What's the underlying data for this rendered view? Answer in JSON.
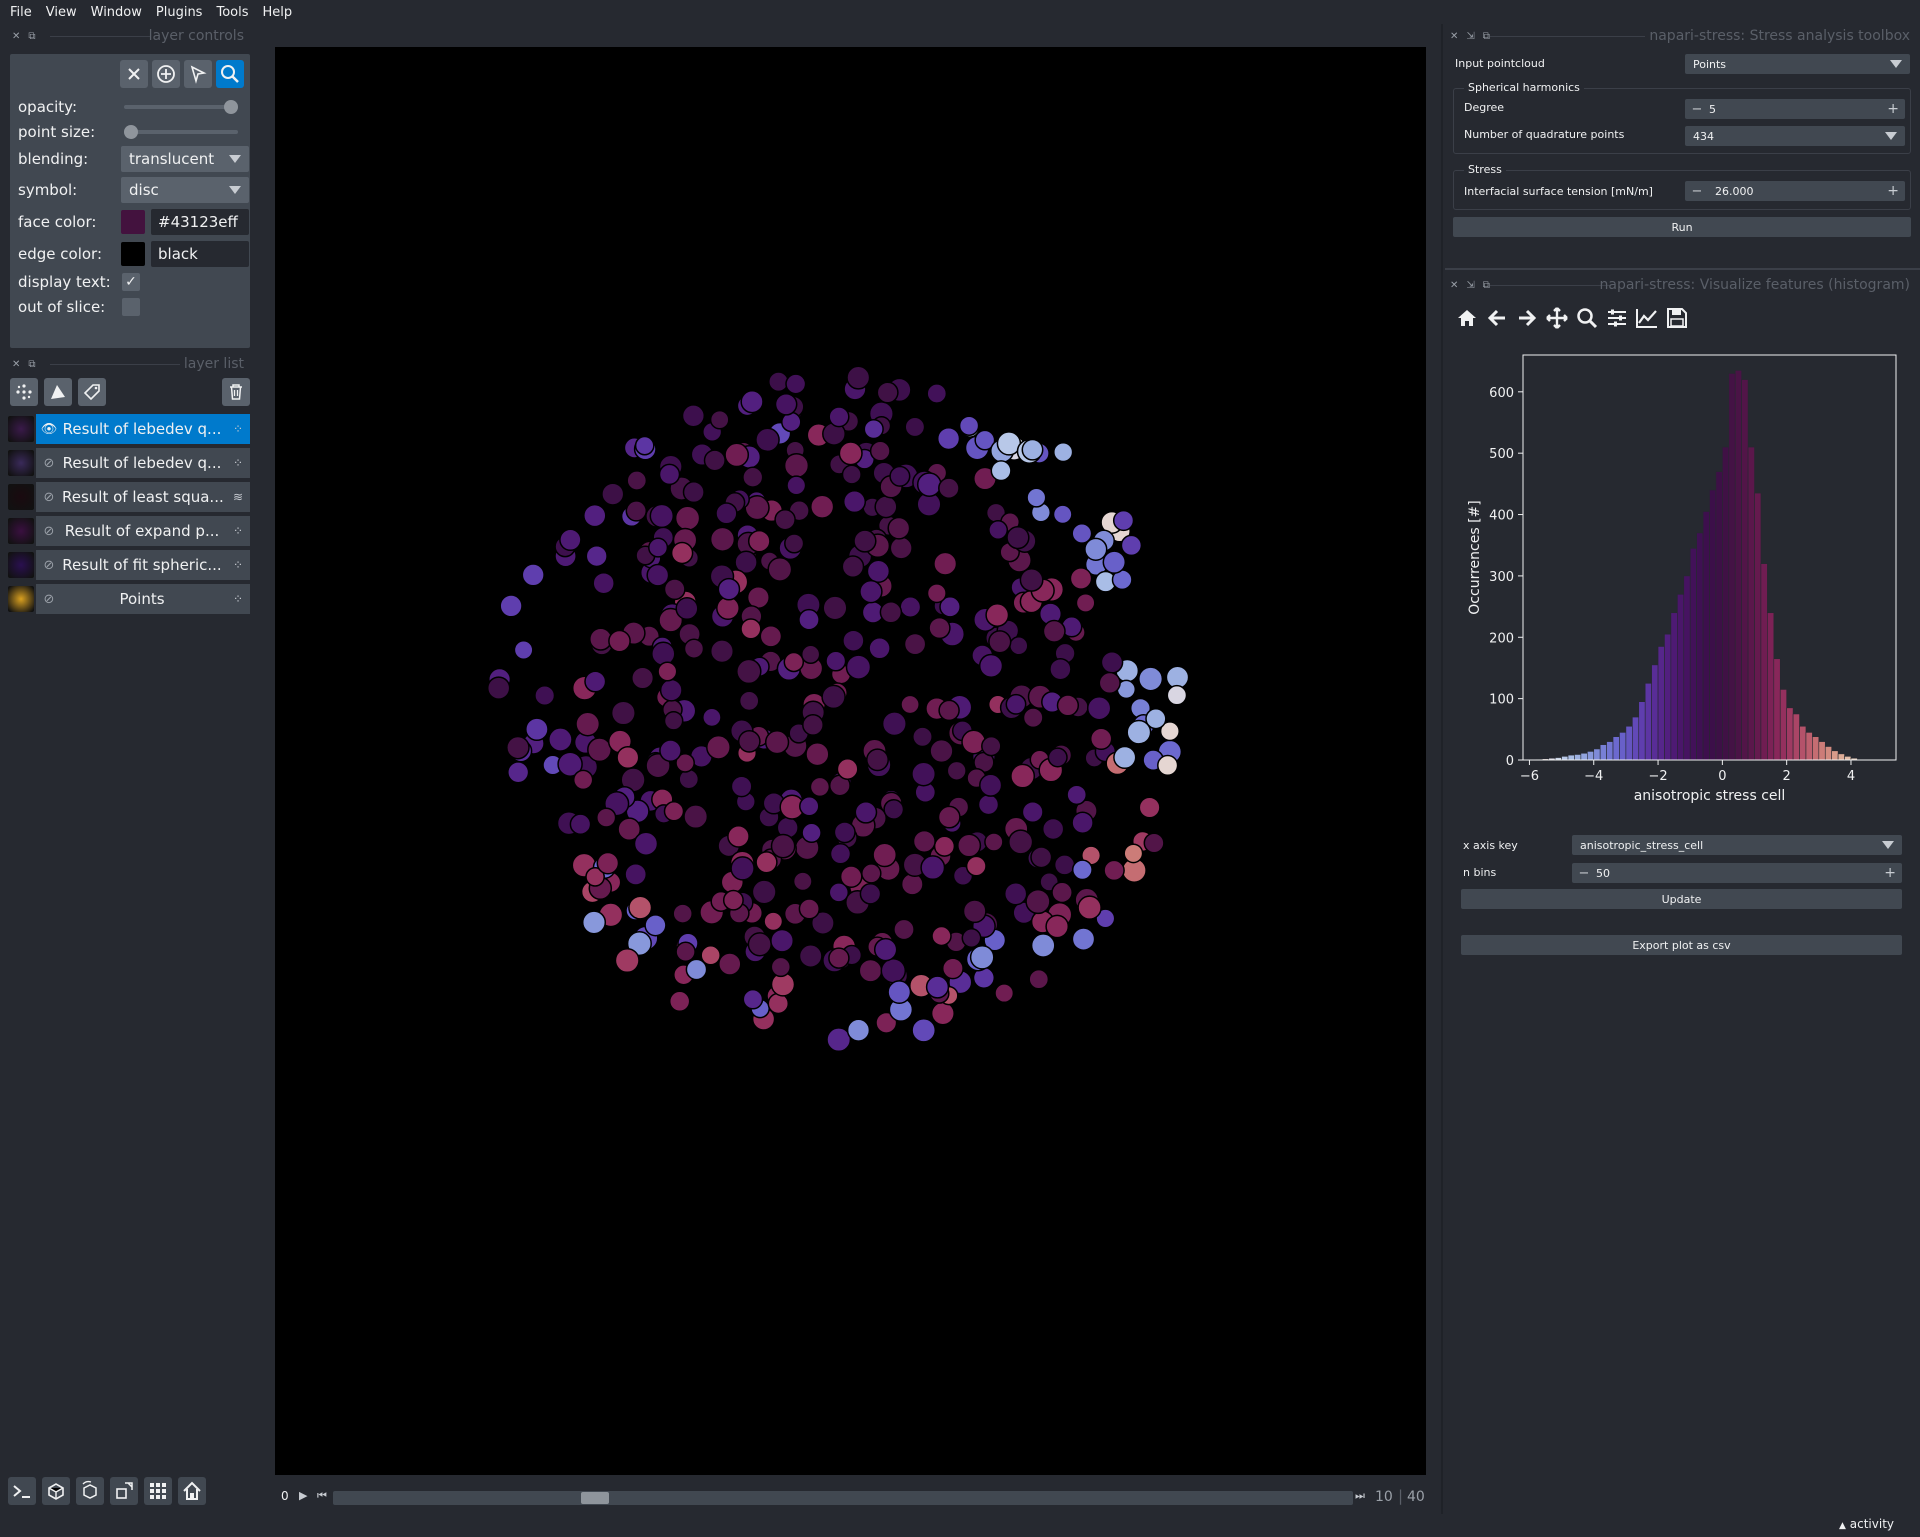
{
  "menubar": {
    "items": [
      "File",
      "View",
      "Window",
      "Plugins",
      "Tools",
      "Help"
    ]
  },
  "layer_controls": {
    "title": "layer controls",
    "opacity_label": "opacity:",
    "opacity_value": 1.0,
    "point_size_label": "point size:",
    "point_size_value": 0.0,
    "blending_label": "blending:",
    "blending_value": "translucent",
    "symbol_label": "symbol:",
    "symbol_value": "disc",
    "face_color_label": "face color:",
    "face_color_value": "#43123eff",
    "face_color_swatch": "#43123e",
    "edge_color_label": "edge color:",
    "edge_color_value": "black",
    "edge_color_swatch": "#000000",
    "display_text_label": "display text:",
    "display_text_checked": true,
    "out_of_slice_label": "out of slice:",
    "out_of_slice_checked": false
  },
  "layer_list": {
    "title": "layer list",
    "layers": [
      {
        "name": "Result of lebedev q...",
        "selected": true,
        "visible": true,
        "type": "points"
      },
      {
        "name": "Result of lebedev q...",
        "selected": false,
        "visible": false,
        "type": "points"
      },
      {
        "name": "Result of least squa...",
        "selected": false,
        "visible": false,
        "type": "vectors"
      },
      {
        "name": "Result of expand p...",
        "selected": false,
        "visible": false,
        "type": "points"
      },
      {
        "name": "Result of fit spheric...",
        "selected": false,
        "visible": false,
        "type": "points"
      },
      {
        "name": "Points",
        "selected": false,
        "visible": false,
        "type": "points"
      }
    ]
  },
  "dims": {
    "start": "0",
    "current": "10",
    "total": "40",
    "position": 0.25
  },
  "stress_toolbox": {
    "title": "napari-stress: Stress analysis toolbox",
    "input_pointcloud_label": "Input pointcloud",
    "input_pointcloud_value": "Points",
    "sph_group": "Spherical harmonics",
    "degree_label": "Degree",
    "degree_value": "5",
    "quad_label": "Number of quadrature points",
    "quad_value": "434",
    "stress_group": "Stress",
    "tension_label": "Interfacial surface tension [mN/m]",
    "tension_value": "26.000",
    "run_label": "Run"
  },
  "histogram_panel": {
    "title": "napari-stress: Visualize features (histogram)",
    "toolbar_icons": [
      "home-icon",
      "back-icon",
      "forward-icon",
      "pan-icon",
      "zoom-icon",
      "configure-icon",
      "edit-axis-icon",
      "save-icon"
    ],
    "x_axis_key_label": "x axis key",
    "x_axis_key_value": "anisotropic_stress_cell",
    "n_bins_label": "n bins",
    "n_bins_value": "50",
    "update_label": "Update",
    "export_label": "Export plot as csv"
  },
  "chart_data": {
    "type": "bar",
    "xlabel": "anisotropic stress cell",
    "ylabel": "Occurrences [#]",
    "xlim": [
      -6.2,
      5.4
    ],
    "ylim": [
      0,
      660
    ],
    "xticks": [
      -6,
      -4,
      -2,
      0,
      2,
      4
    ],
    "xtick_labels": [
      "−6",
      "−4",
      "−2",
      "0",
      "2",
      "4"
    ],
    "yticks": [
      0,
      100,
      200,
      300,
      400,
      500,
      600
    ],
    "yticks_labels": [
      "0",
      "100",
      "200",
      "300",
      "400",
      "500",
      "600"
    ],
    "bin_start": -5.8,
    "bin_width": 0.2,
    "values": [
      1,
      2,
      3,
      4,
      6,
      8,
      9,
      11,
      14,
      18,
      25,
      30,
      38,
      45,
      55,
      70,
      95,
      125,
      155,
      185,
      205,
      240,
      270,
      300,
      345,
      370,
      405,
      440,
      470,
      510,
      630,
      635,
      620,
      510,
      435,
      320,
      240,
      165,
      115,
      85,
      75,
      55,
      45,
      38,
      30,
      22,
      15,
      10,
      6,
      3
    ],
    "colors": [
      "#e8ddd8",
      "#e5d6d2",
      "#d9d6e2",
      "#c8d2e6",
      "#b8c8e8",
      "#a9bde6",
      "#9db1e2",
      "#92a4de",
      "#8898db",
      "#7f8bd8",
      "#7880d5",
      "#7275d2",
      "#6c69cf",
      "#6860c9",
      "#6555c1",
      "#6249b8",
      "#5f3eae",
      "#5c35a3",
      "#592d97",
      "#56268b",
      "#521f7f",
      "#4e1a74",
      "#4a166a",
      "#461361",
      "#421159",
      "#3f1053",
      "#3d0f4d",
      "#3c0f49",
      "#3d1046",
      "#401145",
      "#441245",
      "#4a1346",
      "#521548",
      "#5b174b",
      "#651a4e",
      "#701d52",
      "#7c2256",
      "#88275a",
      "#94305e",
      "#9f3a62",
      "#aa4566",
      "#b4526a",
      "#bd5f6e",
      "#c56d72",
      "#cc7c78",
      "#d28b80",
      "#d89b8a",
      "#ddac97",
      "#e2bda8",
      "#e7cfbd"
    ]
  },
  "viewer_buttons": [
    "console-icon",
    "ndisplay-icon",
    "roll-icon",
    "transpose-icon",
    "grid-icon",
    "home-icon"
  ],
  "status": {
    "activity": "activity"
  }
}
